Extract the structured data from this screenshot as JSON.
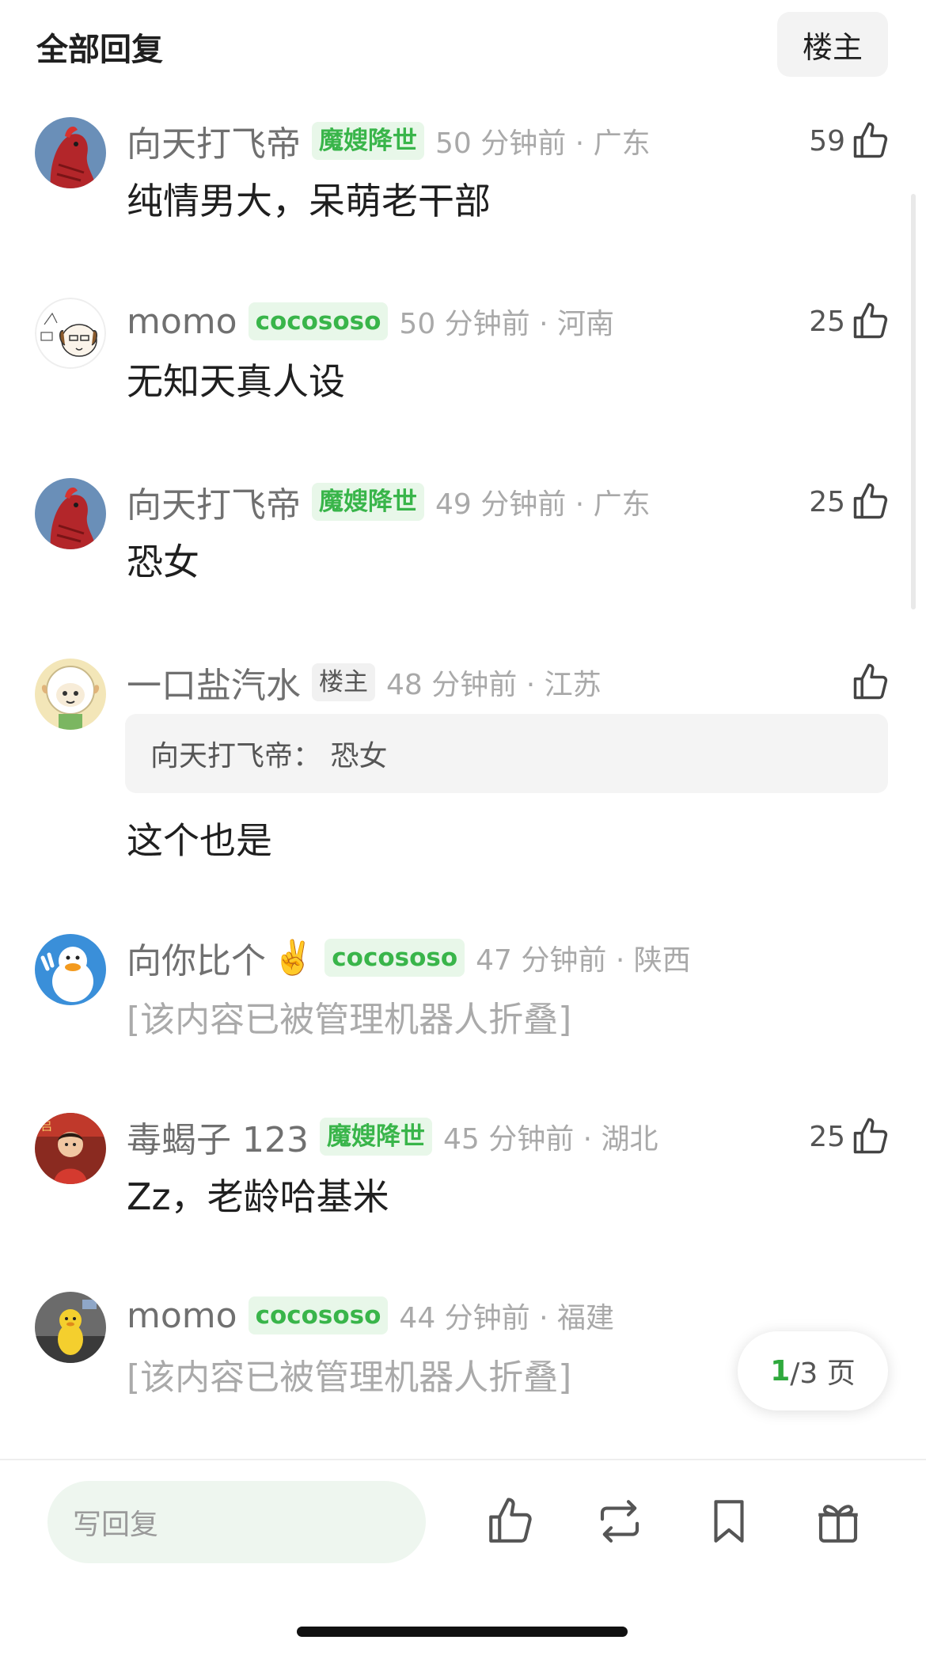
{
  "header": {
    "title": "全部回复",
    "op_filter_label": "楼主"
  },
  "replies": [
    {
      "username": "向天打飞帝",
      "badge": "魔嫂降世",
      "time_location": "50 分钟前 · 广东",
      "likes": "59",
      "content": "纯情男大，呆萌老干部",
      "avatar_icon": "rooster-avatar"
    },
    {
      "username": "momo",
      "badge": "cocososo",
      "time_location": "50 分钟前 · 河南",
      "likes": "25",
      "content": "无知天真人设",
      "avatar_icon": "dog-sketch-avatar"
    },
    {
      "username": "向天打飞帝",
      "badge": "魔嫂降世",
      "time_location": "49 分钟前 · 广东",
      "likes": "25",
      "content": "恐女",
      "avatar_icon": "rooster-avatar"
    },
    {
      "username": "一口盐汽水",
      "badge": "楼主",
      "time_location": "48 分钟前 · 江苏",
      "likes": "",
      "quote": "向天打飞帝： 恐女",
      "content": "这个也是",
      "avatar_icon": "sheep-avatar"
    },
    {
      "username": "向你比个",
      "username_emoji": "✌️",
      "badge": "cocososo",
      "time_location": "47 分钟前 · 陕西",
      "likes": "",
      "content": "[该内容已被管理机器人折叠]",
      "avatar_icon": "duck-avatar"
    },
    {
      "username": "毒蝎子 123",
      "badge": "魔嫂降世",
      "time_location": "45 分钟前 · 湖北",
      "likes": "25",
      "content": "Zz，老龄哈基米",
      "avatar_icon": "red-figure-avatar"
    },
    {
      "username": "momo",
      "badge": "cocososo",
      "time_location": "44 分钟前 · 福建",
      "likes": "",
      "content": "[该内容已被管理机器人折叠]",
      "avatar_icon": "yellow-toy-avatar"
    }
  ],
  "pager": {
    "current": "1",
    "total_text": "/3 页"
  },
  "bottom_bar": {
    "reply_placeholder": "写回复",
    "icons": [
      "thumb-up-icon",
      "repost-icon",
      "bookmark-icon",
      "gift-icon"
    ]
  },
  "colors": {
    "accent_green": "#39b54a",
    "badge_bg": "#e8f7e9",
    "meta_gray": "#a9a9a9"
  }
}
